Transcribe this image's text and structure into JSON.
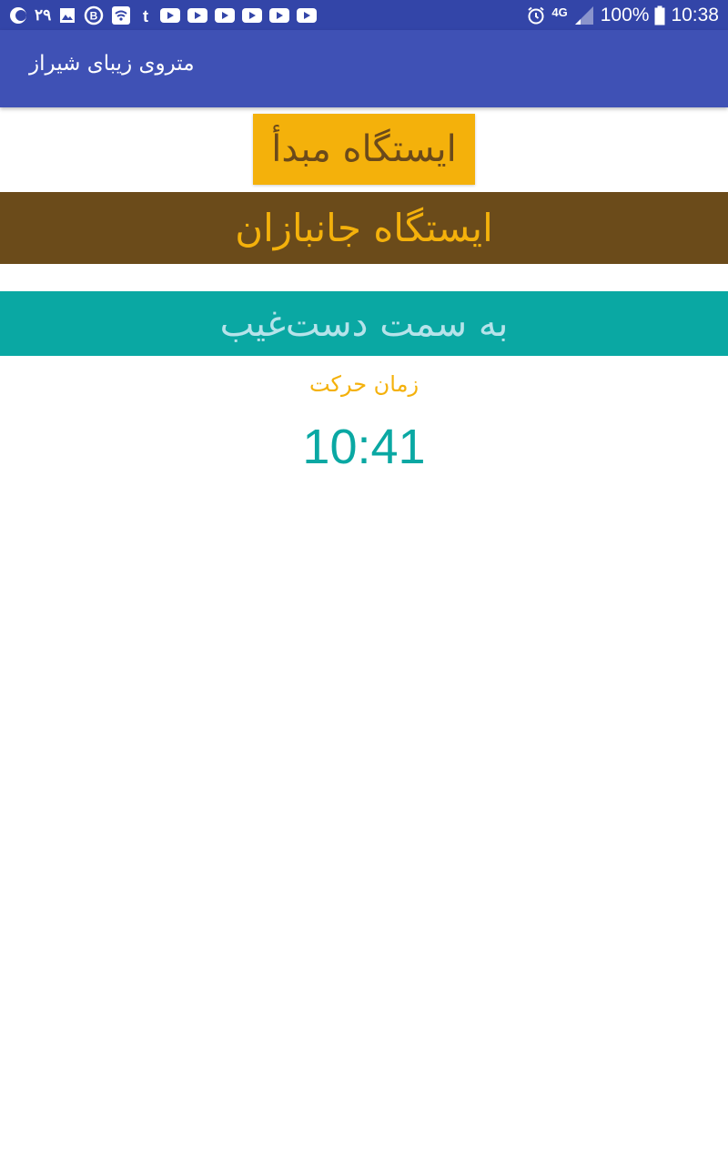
{
  "status_bar": {
    "date_text": "۲۹",
    "network": "4G",
    "battery_percent": "100%",
    "time": "10:38",
    "left_icons": [
      "moon-icon",
      "image-icon",
      "b-circle-icon",
      "wifi-icon",
      "tumblr-icon",
      "youtube-icon",
      "youtube-icon",
      "youtube-icon",
      "youtube-icon",
      "youtube-icon",
      "youtube-icon"
    ],
    "right_icons": [
      "alarm-icon",
      "signal-icon",
      "battery-icon"
    ]
  },
  "app_bar": {
    "title": "متروی زیبای شیراز",
    "color": "#3f51b5"
  },
  "origin": {
    "label": "ایستگاه مبدأ",
    "station": "ایستگاه جانبازان"
  },
  "direction": {
    "label": "به سمت دست‌غیب"
  },
  "departure": {
    "label": "زمان حرکت",
    "time": "10:41"
  },
  "colors": {
    "accent_amber": "#f4b10b",
    "brown": "#6b4b1a",
    "teal": "#0aa8a3"
  }
}
